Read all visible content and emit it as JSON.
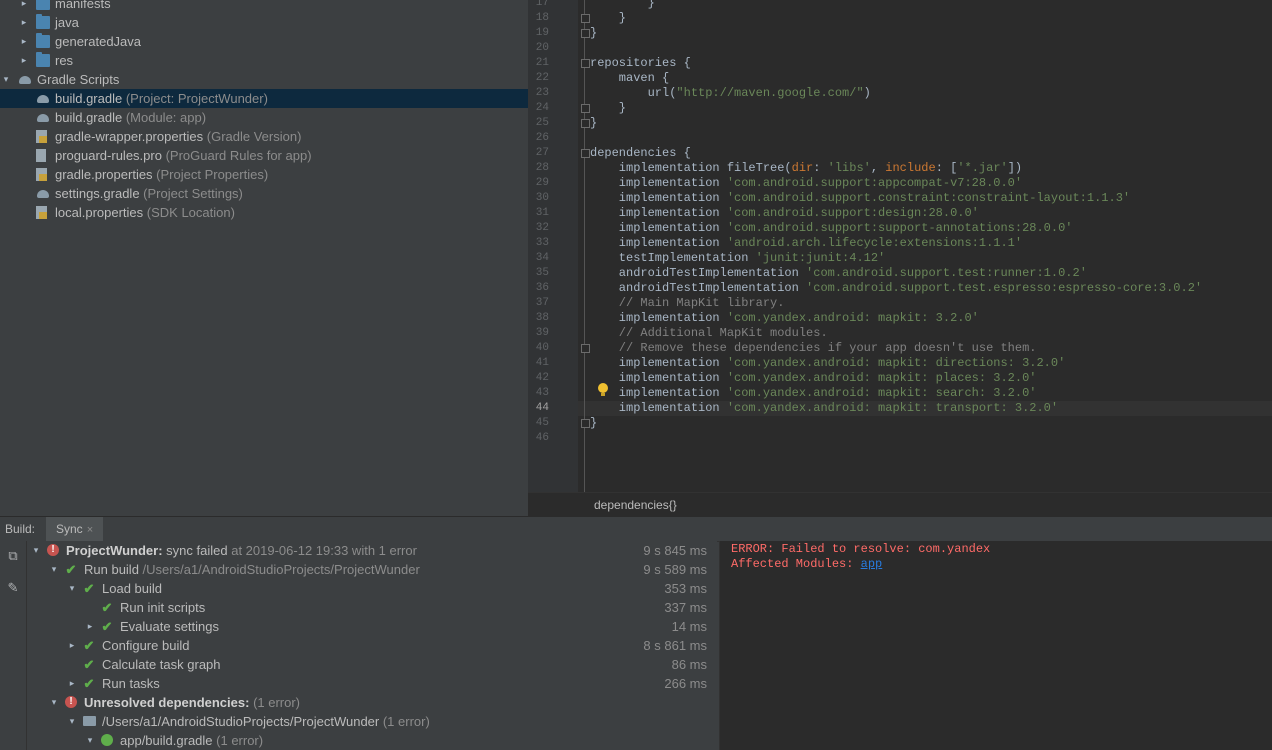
{
  "project_tree": {
    "items": [
      {
        "name": "manifests",
        "hint": "",
        "indent": 2,
        "arrow": "▸",
        "icon": "folder"
      },
      {
        "name": "java",
        "hint": "",
        "indent": 2,
        "arrow": "▸",
        "icon": "folder"
      },
      {
        "name": "generatedJava",
        "hint": "",
        "indent": 2,
        "arrow": "▸",
        "icon": "folder"
      },
      {
        "name": "res",
        "hint": "",
        "indent": 2,
        "arrow": "▸",
        "icon": "folder"
      },
      {
        "name": "Gradle Scripts",
        "hint": "",
        "indent": 1,
        "arrow": "▾",
        "icon": "gradle"
      },
      {
        "name": "build.gradle",
        "hint": " (Project: ProjectWunder)",
        "indent": 2,
        "arrow": "",
        "icon": "gradle",
        "selected": true
      },
      {
        "name": "build.gradle",
        "hint": " (Module: app)",
        "indent": 2,
        "arrow": "",
        "icon": "gradle"
      },
      {
        "name": "gradle-wrapper.properties",
        "hint": " (Gradle Version)",
        "indent": 2,
        "arrow": "",
        "icon": "properties"
      },
      {
        "name": "proguard-rules.pro",
        "hint": " (ProGuard Rules for app)",
        "indent": 2,
        "arrow": "",
        "icon": "text"
      },
      {
        "name": "gradle.properties",
        "hint": " (Project Properties)",
        "indent": 2,
        "arrow": "",
        "icon": "properties"
      },
      {
        "name": "settings.gradle",
        "hint": " (Project Settings)",
        "indent": 2,
        "arrow": "",
        "icon": "gradle"
      },
      {
        "name": "local.properties",
        "hint": " (SDK Location)",
        "indent": 2,
        "arrow": "",
        "icon": "properties"
      }
    ]
  },
  "editor": {
    "current_line": 44,
    "lines": [
      {
        "n": 17,
        "segs": [
          [
            "ident",
            "        }"
          ]
        ]
      },
      {
        "n": 18,
        "segs": [
          [
            "ident",
            "    }"
          ]
        ]
      },
      {
        "n": 19,
        "segs": [
          [
            "ident",
            "}"
          ]
        ]
      },
      {
        "n": 20,
        "segs": []
      },
      {
        "n": 21,
        "segs": [
          [
            "ident",
            "repositories {"
          ]
        ]
      },
      {
        "n": 22,
        "segs": [
          [
            "ident",
            "    maven {"
          ]
        ]
      },
      {
        "n": 23,
        "segs": [
          [
            "ident",
            "        url("
          ],
          [
            "str",
            "\"http://maven.google.com/\""
          ],
          [
            "ident",
            ")"
          ]
        ]
      },
      {
        "n": 24,
        "segs": [
          [
            "ident",
            "    }"
          ]
        ]
      },
      {
        "n": 25,
        "segs": [
          [
            "ident",
            "}"
          ]
        ]
      },
      {
        "n": 26,
        "segs": []
      },
      {
        "n": 27,
        "segs": [
          [
            "ident",
            "dependencies {"
          ]
        ]
      },
      {
        "n": 28,
        "segs": [
          [
            "ident",
            "    implementation fileTree("
          ],
          [
            "kw",
            "dir"
          ],
          [
            "ident",
            ": "
          ],
          [
            "str",
            "'libs'"
          ],
          [
            "ident",
            ", "
          ],
          [
            "kw",
            "include"
          ],
          [
            "ident",
            ": ["
          ],
          [
            "str",
            "'*.jar'"
          ],
          [
            "ident",
            "])"
          ]
        ]
      },
      {
        "n": 29,
        "segs": [
          [
            "ident",
            "    implementation "
          ],
          [
            "str",
            "'com.android.support:appcompat-v7:28.0.0'"
          ]
        ]
      },
      {
        "n": 30,
        "segs": [
          [
            "ident",
            "    implementation "
          ],
          [
            "str",
            "'com.android.support.constraint:constraint-layout:1.1.3'"
          ]
        ]
      },
      {
        "n": 31,
        "segs": [
          [
            "ident",
            "    implementation "
          ],
          [
            "str",
            "'com.android.support:design:28.0.0'"
          ]
        ]
      },
      {
        "n": 32,
        "segs": [
          [
            "ident",
            "    implementation "
          ],
          [
            "str",
            "'com.android.support:support-annotations:28.0.0'"
          ]
        ]
      },
      {
        "n": 33,
        "segs": [
          [
            "ident",
            "    implementation "
          ],
          [
            "str",
            "'android.arch.lifecycle:extensions:1.1.1'"
          ]
        ]
      },
      {
        "n": 34,
        "segs": [
          [
            "ident",
            "    testImplementation "
          ],
          [
            "str",
            "'junit:junit:4.12'"
          ]
        ]
      },
      {
        "n": 35,
        "segs": [
          [
            "ident",
            "    androidTestImplementation "
          ],
          [
            "str",
            "'com.android.support.test:runner:1.0.2'"
          ]
        ]
      },
      {
        "n": 36,
        "segs": [
          [
            "ident",
            "    androidTestImplementation "
          ],
          [
            "str",
            "'com.android.support.test.espresso:espresso-core:3.0.2'"
          ]
        ]
      },
      {
        "n": 37,
        "segs": [
          [
            "cmt",
            "    // Main MapKit library."
          ]
        ]
      },
      {
        "n": 38,
        "segs": [
          [
            "ident",
            "    implementation "
          ],
          [
            "str",
            "'com.yandex.android: mapkit: 3.2.0'"
          ]
        ]
      },
      {
        "n": 39,
        "segs": [
          [
            "cmt",
            "    // Additional MapKit modules."
          ]
        ]
      },
      {
        "n": 40,
        "segs": [
          [
            "cmt",
            "    // Remove these dependencies if your app doesn't use them."
          ]
        ]
      },
      {
        "n": 41,
        "segs": [
          [
            "ident",
            "    implementation "
          ],
          [
            "str",
            "'com.yandex.android: mapkit: directions: 3.2.0'"
          ]
        ]
      },
      {
        "n": 42,
        "segs": [
          [
            "ident",
            "    implementation "
          ],
          [
            "str",
            "'com.yandex.android: mapkit: places: 3.2.0'"
          ]
        ]
      },
      {
        "n": 43,
        "segs": [
          [
            "ident",
            "    implementation "
          ],
          [
            "str",
            "'com.yandex.android: mapkit: search: 3.2.0'"
          ]
        ]
      },
      {
        "n": 44,
        "segs": [
          [
            "ident",
            "    implementation "
          ],
          [
            "str",
            "'com.yandex.android: mapkit: transport: 3.2.0'"
          ]
        ]
      },
      {
        "n": 45,
        "segs": [
          [
            "ident",
            "}"
          ]
        ]
      },
      {
        "n": 46,
        "segs": []
      }
    ],
    "breadcrumb": "dependencies{}"
  },
  "build_window": {
    "title": "Build:",
    "tab_label": "Sync",
    "tab_close": "×",
    "toolbar_icons": [
      "restore-layout-icon",
      "pin-icon"
    ],
    "rows": [
      {
        "indent": 0,
        "arrow": "▾",
        "status": "error",
        "label": "ProjectWunder:",
        "label_suffix": " sync failed",
        "dim": " at 2019-06-12 19:33  with 1 error",
        "time": "9 s 845 ms"
      },
      {
        "indent": 1,
        "arrow": "▾",
        "status": "ok",
        "label": "Run build",
        "label_suffix": "",
        "dim": " /Users/a1/AndroidStudioProjects/ProjectWunder",
        "time": "9 s 589 ms"
      },
      {
        "indent": 2,
        "arrow": "▾",
        "status": "ok",
        "label": "Load build",
        "label_suffix": "",
        "dim": "",
        "time": "353 ms"
      },
      {
        "indent": 3,
        "arrow": "",
        "status": "ok",
        "label": "Run init scripts",
        "label_suffix": "",
        "dim": "",
        "time": "337 ms"
      },
      {
        "indent": 3,
        "arrow": "▸",
        "status": "ok",
        "label": "Evaluate settings",
        "label_suffix": "",
        "dim": "",
        "time": "14 ms"
      },
      {
        "indent": 2,
        "arrow": "▸",
        "status": "ok",
        "label": "Configure build",
        "label_suffix": "",
        "dim": "",
        "time": "8 s 861 ms"
      },
      {
        "indent": 2,
        "arrow": "",
        "status": "ok",
        "label": "Calculate task graph",
        "label_suffix": "",
        "dim": "",
        "time": "86 ms"
      },
      {
        "indent": 2,
        "arrow": "▸",
        "status": "ok",
        "label": "Run tasks",
        "label_suffix": "",
        "dim": "",
        "time": "266 ms"
      },
      {
        "indent": 1,
        "arrow": "▾",
        "status": "error",
        "label": "Unresolved dependencies:",
        "label_suffix": "",
        "dim": "  (1 error)",
        "time": ""
      },
      {
        "indent": 2,
        "arrow": "▾",
        "status": "folder",
        "label": "/Users/a1/AndroidStudioProjects/ProjectWunder",
        "label_suffix": "",
        "dim": "  (1 error)",
        "time": ""
      },
      {
        "indent": 3,
        "arrow": "▾",
        "status": "gradlefile",
        "label": "app/build.gradle",
        "label_suffix": "",
        "dim": "  (1 error)",
        "time": ""
      }
    ]
  },
  "console": {
    "line1": "ERROR: Failed to resolve: com.yandex",
    "line2_prefix": "Affected Modules: ",
    "line2_link": "app"
  }
}
